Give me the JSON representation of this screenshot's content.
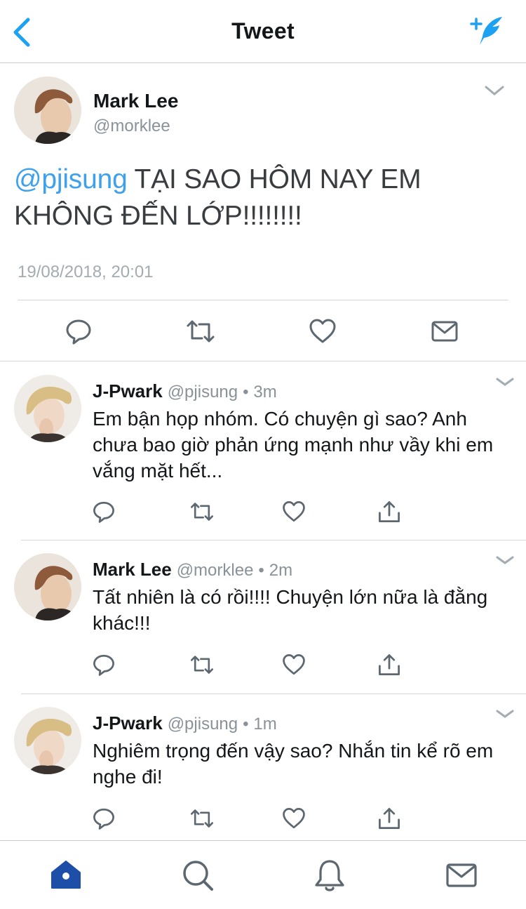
{
  "header": {
    "title": "Tweet",
    "back_icon": "chevron-left-icon",
    "compose_icon": "compose-feather-icon"
  },
  "main_tweet": {
    "name": "Mark Lee",
    "handle": "@morklee",
    "mention": "@pjisung",
    "text": " TẠI SAO HÔM NAY EM KHÔNG ĐẾN LỚP!!!!!!!!",
    "timestamp": "19/08/2018, 20:01",
    "actions": [
      "reply-icon",
      "retweet-icon",
      "like-icon",
      "message-icon"
    ]
  },
  "replies": [
    {
      "name": "J-Pwark",
      "handle": "@pjisung",
      "dot": "•",
      "time": "3m",
      "text": "Em bận họp nhóm. Có chuyện gì sao? Anh chưa bao giờ phản ứng mạnh như vầy khi em vắng mặt hết..."
    },
    {
      "name": "Mark Lee",
      "handle": "@morklee",
      "dot": "•",
      "time": "2m",
      "text": "Tất nhiên là có rồi!!!! Chuyện lớn nữa là đằng khác!!!"
    },
    {
      "name": "J-Pwark",
      "handle": "@pjisung",
      "dot": "•",
      "time": "1m",
      "text": "Nghiêm trọng đến vậy sao? Nhắn tin kể rõ em nghe đi!"
    }
  ],
  "tabbar": {
    "items": [
      "home-icon",
      "search-icon",
      "notifications-icon",
      "messages-icon"
    ],
    "active": "home-icon"
  },
  "colors": {
    "accent": "#1da1f2",
    "mention": "#3ea1ec",
    "icon_gray": "#5c6770",
    "active_tab": "#1e4fa8"
  }
}
